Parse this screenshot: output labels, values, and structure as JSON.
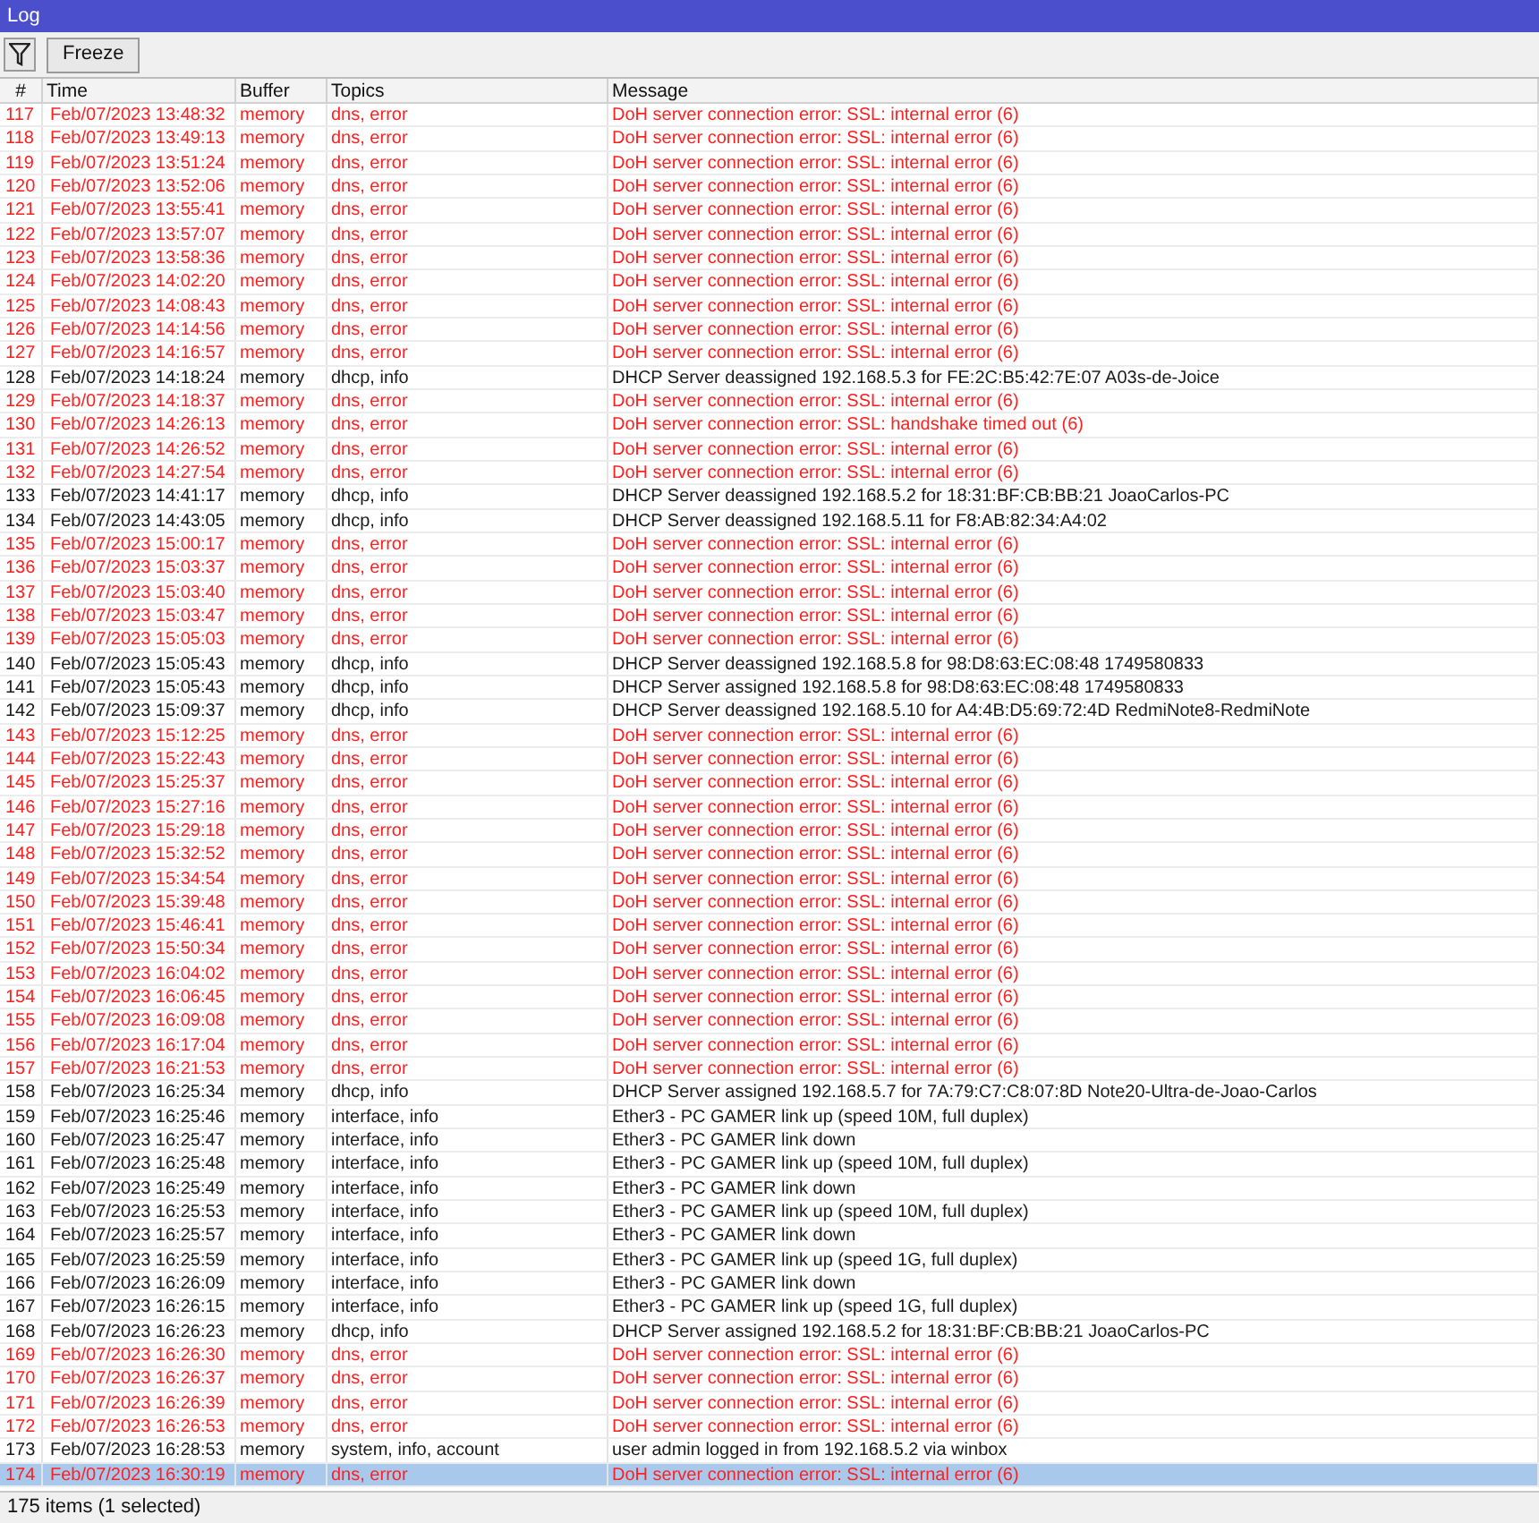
{
  "window": {
    "title": "Log"
  },
  "toolbar": {
    "freeze_button": "Freeze"
  },
  "table": {
    "columns": [
      "#",
      "Time",
      "Buffer",
      "Topics",
      "Message"
    ],
    "rows": [
      {
        "number": "117",
        "time": "Feb/07/2023 13:48:32",
        "buffer": "memory",
        "topics": "dns, error",
        "message": "DoH server connection error: SSL: internal error (6)",
        "kind": "error",
        "selected": false
      },
      {
        "number": "118",
        "time": "Feb/07/2023 13:49:13",
        "buffer": "memory",
        "topics": "dns, error",
        "message": "DoH server connection error: SSL: internal error (6)",
        "kind": "error",
        "selected": false
      },
      {
        "number": "119",
        "time": "Feb/07/2023 13:51:24",
        "buffer": "memory",
        "topics": "dns, error",
        "message": "DoH server connection error: SSL: internal error (6)",
        "kind": "error",
        "selected": false
      },
      {
        "number": "120",
        "time": "Feb/07/2023 13:52:06",
        "buffer": "memory",
        "topics": "dns, error",
        "message": "DoH server connection error: SSL: internal error (6)",
        "kind": "error",
        "selected": false
      },
      {
        "number": "121",
        "time": "Feb/07/2023 13:55:41",
        "buffer": "memory",
        "topics": "dns, error",
        "message": "DoH server connection error: SSL: internal error (6)",
        "kind": "error",
        "selected": false
      },
      {
        "number": "122",
        "time": "Feb/07/2023 13:57:07",
        "buffer": "memory",
        "topics": "dns, error",
        "message": "DoH server connection error: SSL: internal error (6)",
        "kind": "error",
        "selected": false
      },
      {
        "number": "123",
        "time": "Feb/07/2023 13:58:36",
        "buffer": "memory",
        "topics": "dns, error",
        "message": "DoH server connection error: SSL: internal error (6)",
        "kind": "error",
        "selected": false
      },
      {
        "number": "124",
        "time": "Feb/07/2023 14:02:20",
        "buffer": "memory",
        "topics": "dns, error",
        "message": "DoH server connection error: SSL: internal error (6)",
        "kind": "error",
        "selected": false
      },
      {
        "number": "125",
        "time": "Feb/07/2023 14:08:43",
        "buffer": "memory",
        "topics": "dns, error",
        "message": "DoH server connection error: SSL: internal error (6)",
        "kind": "error",
        "selected": false
      },
      {
        "number": "126",
        "time": "Feb/07/2023 14:14:56",
        "buffer": "memory",
        "topics": "dns, error",
        "message": "DoH server connection error: SSL: internal error (6)",
        "kind": "error",
        "selected": false
      },
      {
        "number": "127",
        "time": "Feb/07/2023 14:16:57",
        "buffer": "memory",
        "topics": "dns, error",
        "message": "DoH server connection error: SSL: internal error (6)",
        "kind": "error",
        "selected": false
      },
      {
        "number": "128",
        "time": "Feb/07/2023 14:18:24",
        "buffer": "memory",
        "topics": "dhcp, info",
        "message": "DHCP Server deassigned 192.168.5.3 for FE:2C:B5:42:7E:07 A03s-de-Joice",
        "kind": "info",
        "selected": false
      },
      {
        "number": "129",
        "time": "Feb/07/2023 14:18:37",
        "buffer": "memory",
        "topics": "dns, error",
        "message": "DoH server connection error: SSL: internal error (6)",
        "kind": "error",
        "selected": false
      },
      {
        "number": "130",
        "time": "Feb/07/2023 14:26:13",
        "buffer": "memory",
        "topics": "dns, error",
        "message": "DoH server connection error: SSL: handshake timed out (6)",
        "kind": "error",
        "selected": false
      },
      {
        "number": "131",
        "time": "Feb/07/2023 14:26:52",
        "buffer": "memory",
        "topics": "dns, error",
        "message": "DoH server connection error: SSL: internal error (6)",
        "kind": "error",
        "selected": false
      },
      {
        "number": "132",
        "time": "Feb/07/2023 14:27:54",
        "buffer": "memory",
        "topics": "dns, error",
        "message": "DoH server connection error: SSL: internal error (6)",
        "kind": "error",
        "selected": false
      },
      {
        "number": "133",
        "time": "Feb/07/2023 14:41:17",
        "buffer": "memory",
        "topics": "dhcp, info",
        "message": "DHCP Server deassigned 192.168.5.2 for 18:31:BF:CB:BB:21 JoaoCarlos-PC",
        "kind": "info",
        "selected": false
      },
      {
        "number": "134",
        "time": "Feb/07/2023 14:43:05",
        "buffer": "memory",
        "topics": "dhcp, info",
        "message": "DHCP Server deassigned 192.168.5.11 for F8:AB:82:34:A4:02",
        "kind": "info",
        "selected": false
      },
      {
        "number": "135",
        "time": "Feb/07/2023 15:00:17",
        "buffer": "memory",
        "topics": "dns, error",
        "message": "DoH server connection error: SSL: internal error (6)",
        "kind": "error",
        "selected": false
      },
      {
        "number": "136",
        "time": "Feb/07/2023 15:03:37",
        "buffer": "memory",
        "topics": "dns, error",
        "message": "DoH server connection error: SSL: internal error (6)",
        "kind": "error",
        "selected": false
      },
      {
        "number": "137",
        "time": "Feb/07/2023 15:03:40",
        "buffer": "memory",
        "topics": "dns, error",
        "message": "DoH server connection error: SSL: internal error (6)",
        "kind": "error",
        "selected": false
      },
      {
        "number": "138",
        "time": "Feb/07/2023 15:03:47",
        "buffer": "memory",
        "topics": "dns, error",
        "message": "DoH server connection error: SSL: internal error (6)",
        "kind": "error",
        "selected": false
      },
      {
        "number": "139",
        "time": "Feb/07/2023 15:05:03",
        "buffer": "memory",
        "topics": "dns, error",
        "message": "DoH server connection error: SSL: internal error (6)",
        "kind": "error",
        "selected": false
      },
      {
        "number": "140",
        "time": "Feb/07/2023 15:05:43",
        "buffer": "memory",
        "topics": "dhcp, info",
        "message": "DHCP Server deassigned 192.168.5.8 for 98:D8:63:EC:08:48 1749580833",
        "kind": "info",
        "selected": false
      },
      {
        "number": "141",
        "time": "Feb/07/2023 15:05:43",
        "buffer": "memory",
        "topics": "dhcp, info",
        "message": "DHCP Server assigned 192.168.5.8 for 98:D8:63:EC:08:48 1749580833",
        "kind": "info",
        "selected": false
      },
      {
        "number": "142",
        "time": "Feb/07/2023 15:09:37",
        "buffer": "memory",
        "topics": "dhcp, info",
        "message": "DHCP Server deassigned 192.168.5.10 for A4:4B:D5:69:72:4D RedmiNote8-RedmiNote",
        "kind": "info",
        "selected": false
      },
      {
        "number": "143",
        "time": "Feb/07/2023 15:12:25",
        "buffer": "memory",
        "topics": "dns, error",
        "message": "DoH server connection error: SSL: internal error (6)",
        "kind": "error",
        "selected": false
      },
      {
        "number": "144",
        "time": "Feb/07/2023 15:22:43",
        "buffer": "memory",
        "topics": "dns, error",
        "message": "DoH server connection error: SSL: internal error (6)",
        "kind": "error",
        "selected": false
      },
      {
        "number": "145",
        "time": "Feb/07/2023 15:25:37",
        "buffer": "memory",
        "topics": "dns, error",
        "message": "DoH server connection error: SSL: internal error (6)",
        "kind": "error",
        "selected": false
      },
      {
        "number": "146",
        "time": "Feb/07/2023 15:27:16",
        "buffer": "memory",
        "topics": "dns, error",
        "message": "DoH server connection error: SSL: internal error (6)",
        "kind": "error",
        "selected": false
      },
      {
        "number": "147",
        "time": "Feb/07/2023 15:29:18",
        "buffer": "memory",
        "topics": "dns, error",
        "message": "DoH server connection error: SSL: internal error (6)",
        "kind": "error",
        "selected": false
      },
      {
        "number": "148",
        "time": "Feb/07/2023 15:32:52",
        "buffer": "memory",
        "topics": "dns, error",
        "message": "DoH server connection error: SSL: internal error (6)",
        "kind": "error",
        "selected": false
      },
      {
        "number": "149",
        "time": "Feb/07/2023 15:34:54",
        "buffer": "memory",
        "topics": "dns, error",
        "message": "DoH server connection error: SSL: internal error (6)",
        "kind": "error",
        "selected": false
      },
      {
        "number": "150",
        "time": "Feb/07/2023 15:39:48",
        "buffer": "memory",
        "topics": "dns, error",
        "message": "DoH server connection error: SSL: internal error (6)",
        "kind": "error",
        "selected": false
      },
      {
        "number": "151",
        "time": "Feb/07/2023 15:46:41",
        "buffer": "memory",
        "topics": "dns, error",
        "message": "DoH server connection error: SSL: internal error (6)",
        "kind": "error",
        "selected": false
      },
      {
        "number": "152",
        "time": "Feb/07/2023 15:50:34",
        "buffer": "memory",
        "topics": "dns, error",
        "message": "DoH server connection error: SSL: internal error (6)",
        "kind": "error",
        "selected": false
      },
      {
        "number": "153",
        "time": "Feb/07/2023 16:04:02",
        "buffer": "memory",
        "topics": "dns, error",
        "message": "DoH server connection error: SSL: internal error (6)",
        "kind": "error",
        "selected": false
      },
      {
        "number": "154",
        "time": "Feb/07/2023 16:06:45",
        "buffer": "memory",
        "topics": "dns, error",
        "message": "DoH server connection error: SSL: internal error (6)",
        "kind": "error",
        "selected": false
      },
      {
        "number": "155",
        "time": "Feb/07/2023 16:09:08",
        "buffer": "memory",
        "topics": "dns, error",
        "message": "DoH server connection error: SSL: internal error (6)",
        "kind": "error",
        "selected": false
      },
      {
        "number": "156",
        "time": "Feb/07/2023 16:17:04",
        "buffer": "memory",
        "topics": "dns, error",
        "message": "DoH server connection error: SSL: internal error (6)",
        "kind": "error",
        "selected": false
      },
      {
        "number": "157",
        "time": "Feb/07/2023 16:21:53",
        "buffer": "memory",
        "topics": "dns, error",
        "message": "DoH server connection error: SSL: internal error (6)",
        "kind": "error",
        "selected": false
      },
      {
        "number": "158",
        "time": "Feb/07/2023 16:25:34",
        "buffer": "memory",
        "topics": "dhcp, info",
        "message": "DHCP Server assigned 192.168.5.7 for 7A:79:C7:C8:07:8D Note20-Ultra-de-Joao-Carlos",
        "kind": "info",
        "selected": false
      },
      {
        "number": "159",
        "time": "Feb/07/2023 16:25:46",
        "buffer": "memory",
        "topics": "interface, info",
        "message": "Ether3 - PC GAMER link up (speed 10M, full duplex)",
        "kind": "info",
        "selected": false
      },
      {
        "number": "160",
        "time": "Feb/07/2023 16:25:47",
        "buffer": "memory",
        "topics": "interface, info",
        "message": "Ether3 - PC GAMER link down",
        "kind": "info",
        "selected": false
      },
      {
        "number": "161",
        "time": "Feb/07/2023 16:25:48",
        "buffer": "memory",
        "topics": "interface, info",
        "message": "Ether3 - PC GAMER link up (speed 10M, full duplex)",
        "kind": "info",
        "selected": false
      },
      {
        "number": "162",
        "time": "Feb/07/2023 16:25:49",
        "buffer": "memory",
        "topics": "interface, info",
        "message": "Ether3 - PC GAMER link down",
        "kind": "info",
        "selected": false
      },
      {
        "number": "163",
        "time": "Feb/07/2023 16:25:53",
        "buffer": "memory",
        "topics": "interface, info",
        "message": "Ether3 - PC GAMER link up (speed 10M, full duplex)",
        "kind": "info",
        "selected": false
      },
      {
        "number": "164",
        "time": "Feb/07/2023 16:25:57",
        "buffer": "memory",
        "topics": "interface, info",
        "message": "Ether3 - PC GAMER link down",
        "kind": "info",
        "selected": false
      },
      {
        "number": "165",
        "time": "Feb/07/2023 16:25:59",
        "buffer": "memory",
        "topics": "interface, info",
        "message": "Ether3 - PC GAMER link up (speed 1G, full duplex)",
        "kind": "info",
        "selected": false
      },
      {
        "number": "166",
        "time": "Feb/07/2023 16:26:09",
        "buffer": "memory",
        "topics": "interface, info",
        "message": "Ether3 - PC GAMER link down",
        "kind": "info",
        "selected": false
      },
      {
        "number": "167",
        "time": "Feb/07/2023 16:26:15",
        "buffer": "memory",
        "topics": "interface, info",
        "message": "Ether3 - PC GAMER link up (speed 1G, full duplex)",
        "kind": "info",
        "selected": false
      },
      {
        "number": "168",
        "time": "Feb/07/2023 16:26:23",
        "buffer": "memory",
        "topics": "dhcp, info",
        "message": "DHCP Server assigned 192.168.5.2 for 18:31:BF:CB:BB:21 JoaoCarlos-PC",
        "kind": "info",
        "selected": false
      },
      {
        "number": "169",
        "time": "Feb/07/2023 16:26:30",
        "buffer": "memory",
        "topics": "dns, error",
        "message": "DoH server connection error: SSL: internal error (6)",
        "kind": "error",
        "selected": false
      },
      {
        "number": "170",
        "time": "Feb/07/2023 16:26:37",
        "buffer": "memory",
        "topics": "dns, error",
        "message": "DoH server connection error: SSL: internal error (6)",
        "kind": "error",
        "selected": false
      },
      {
        "number": "171",
        "time": "Feb/07/2023 16:26:39",
        "buffer": "memory",
        "topics": "dns, error",
        "message": "DoH server connection error: SSL: internal error (6)",
        "kind": "error",
        "selected": false
      },
      {
        "number": "172",
        "time": "Feb/07/2023 16:26:53",
        "buffer": "memory",
        "topics": "dns, error",
        "message": "DoH server connection error: SSL: internal error (6)",
        "kind": "error",
        "selected": false
      },
      {
        "number": "173",
        "time": "Feb/07/2023 16:28:53",
        "buffer": "memory",
        "topics": "system, info, account",
        "message": "user admin logged in from 192.168.5.2 via winbox",
        "kind": "info",
        "selected": false
      },
      {
        "number": "174",
        "time": "Feb/07/2023 16:30:19",
        "buffer": "memory",
        "topics": "dns, error",
        "message": "DoH server connection error: SSL: internal error (6)",
        "kind": "error",
        "selected": true
      }
    ]
  },
  "status_bar": "175 items (1 selected)"
}
